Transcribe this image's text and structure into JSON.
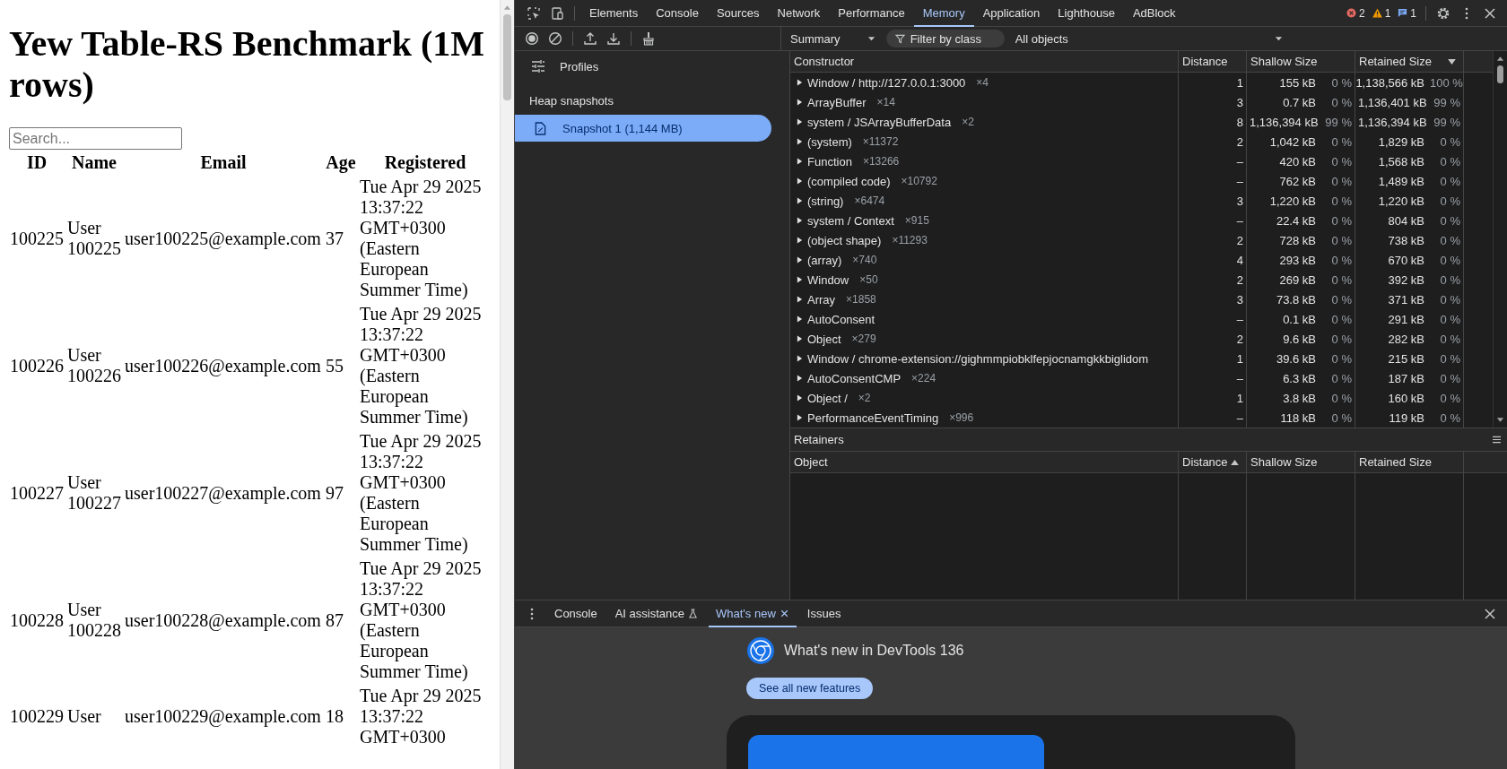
{
  "page": {
    "title": "Yew Table-RS Benchmark (1M rows)",
    "search": {
      "placeholder": "Search..."
    },
    "table": {
      "columns": [
        "ID",
        "Name",
        "Email",
        "Age",
        "Registered"
      ],
      "rows": [
        {
          "id": "100225",
          "name": "User 100225",
          "email": "user100225@example.com",
          "age": "37",
          "registered": "Tue Apr 29 2025 13:37:22 GMT+0300 (Eastern European Summer Time)"
        },
        {
          "id": "100226",
          "name": "User 100226",
          "email": "user100226@example.com",
          "age": "55",
          "registered": "Tue Apr 29 2025 13:37:22 GMT+0300 (Eastern European Summer Time)"
        },
        {
          "id": "100227",
          "name": "User 100227",
          "email": "user100227@example.com",
          "age": "97",
          "registered": "Tue Apr 29 2025 13:37:22 GMT+0300 (Eastern European Summer Time)"
        },
        {
          "id": "100228",
          "name": "User 100228",
          "email": "user100228@example.com",
          "age": "87",
          "registered": "Tue Apr 29 2025 13:37:22 GMT+0300 (Eastern European Summer Time)"
        },
        {
          "id": "100229",
          "name": "User",
          "email": "user100229@example.com",
          "age": "18",
          "registered": "Tue Apr 29 2025 13:37:22 GMT+0300"
        }
      ]
    }
  },
  "devtools": {
    "tabs": [
      {
        "label": "Elements",
        "selected": false
      },
      {
        "label": "Console",
        "selected": false
      },
      {
        "label": "Sources",
        "selected": false
      },
      {
        "label": "Network",
        "selected": false
      },
      {
        "label": "Performance",
        "selected": false
      },
      {
        "label": "Memory",
        "selected": true
      },
      {
        "label": "Application",
        "selected": false
      },
      {
        "label": "Lighthouse",
        "selected": false
      },
      {
        "label": "AdBlock",
        "selected": false
      }
    ],
    "status": {
      "errors": "2",
      "warnings": "1",
      "messages": "1"
    },
    "toolbar": {
      "view": "Summary",
      "filter_placeholder": "Filter by class",
      "scope": "All objects"
    },
    "sidebar": {
      "profiles": "Profiles",
      "section": "Heap snapshots",
      "snapshots": [
        {
          "label": "Snapshot 1 (1,144 MB)",
          "selected": true
        }
      ]
    },
    "heap_table": {
      "columns": [
        {
          "label": "Constructor",
          "sorted": false
        },
        {
          "label": "Distance",
          "sorted": false
        },
        {
          "label": "Shallow Size",
          "sorted": false
        },
        {
          "label": "Retained Size",
          "sorted": true,
          "ascending": false
        }
      ],
      "rows": [
        {
          "constructor": "Window / http://127.0.0.1:3000",
          "count": "×4",
          "expanded": false,
          "distance": "1",
          "shallow": "155 kB",
          "shallow_pct": "0 %",
          "retained": "1,138,566 kB",
          "retained_pct": "100 %"
        },
        {
          "constructor": "ArrayBuffer",
          "count": "×14",
          "expanded": false,
          "distance": "3",
          "shallow": "0.7 kB",
          "shallow_pct": "0 %",
          "retained": "1,136,401 kB",
          "retained_pct": "99 %"
        },
        {
          "constructor": "system / JSArrayBufferData",
          "count": "×2",
          "expanded": false,
          "distance": "8",
          "shallow": "1,136,394 kB",
          "shallow_pct": "99 %",
          "retained": "1,136,394 kB",
          "retained_pct": "99 %"
        },
        {
          "constructor": "(system)",
          "count": "×11372",
          "expanded": false,
          "distance": "2",
          "shallow": "1,042 kB",
          "shallow_pct": "0 %",
          "retained": "1,829 kB",
          "retained_pct": "0 %"
        },
        {
          "constructor": "Function",
          "count": "×13266",
          "expanded": false,
          "distance": "–",
          "shallow": "420 kB",
          "shallow_pct": "0 %",
          "retained": "1,568 kB",
          "retained_pct": "0 %"
        },
        {
          "constructor": "(compiled code)",
          "count": "×10792",
          "expanded": false,
          "distance": "–",
          "shallow": "762 kB",
          "shallow_pct": "0 %",
          "retained": "1,489 kB",
          "retained_pct": "0 %"
        },
        {
          "constructor": "(string)",
          "count": "×6474",
          "expanded": false,
          "distance": "3",
          "shallow": "1,220 kB",
          "shallow_pct": "0 %",
          "retained": "1,220 kB",
          "retained_pct": "0 %"
        },
        {
          "constructor": "system / Context",
          "count": "×915",
          "expanded": false,
          "distance": "–",
          "shallow": "22.4 kB",
          "shallow_pct": "0 %",
          "retained": "804 kB",
          "retained_pct": "0 %"
        },
        {
          "constructor": "(object shape)",
          "count": "×11293",
          "expanded": false,
          "distance": "2",
          "shallow": "728 kB",
          "shallow_pct": "0 %",
          "retained": "738 kB",
          "retained_pct": "0 %"
        },
        {
          "constructor": "(array)",
          "count": "×740",
          "expanded": false,
          "distance": "4",
          "shallow": "293 kB",
          "shallow_pct": "0 %",
          "retained": "670 kB",
          "retained_pct": "0 %"
        },
        {
          "constructor": "Window",
          "count": "×50",
          "expanded": false,
          "distance": "2",
          "shallow": "269 kB",
          "shallow_pct": "0 %",
          "retained": "392 kB",
          "retained_pct": "0 %"
        },
        {
          "constructor": "Array",
          "count": "×1858",
          "expanded": false,
          "distance": "3",
          "shallow": "73.8 kB",
          "shallow_pct": "0 %",
          "retained": "371 kB",
          "retained_pct": "0 %"
        },
        {
          "constructor": "AutoConsent",
          "expanded": false,
          "distance": "–",
          "shallow": "0.1 kB",
          "shallow_pct": "0 %",
          "retained": "291 kB",
          "retained_pct": "0 %"
        },
        {
          "constructor": "Object",
          "count": "×279",
          "expanded": false,
          "distance": "2",
          "shallow": "9.6 kB",
          "shallow_pct": "0 %",
          "retained": "282 kB",
          "retained_pct": "0 %"
        },
        {
          "constructor": "Window / chrome-extension://gighmmpiobklfepjocnamgkkbiglidom",
          "expanded": false,
          "distance": "1",
          "shallow": "39.6 kB",
          "shallow_pct": "0 %",
          "retained": "215 kB",
          "retained_pct": "0 %"
        },
        {
          "constructor": "AutoConsentCMP",
          "count": "×224",
          "expanded": false,
          "distance": "–",
          "shallow": "6.3 kB",
          "shallow_pct": "0 %",
          "retained": "187 kB",
          "retained_pct": "0 %"
        },
        {
          "constructor": "Object /",
          "count": "×2",
          "expanded": false,
          "distance": "1",
          "shallow": "3.8 kB",
          "shallow_pct": "0 %",
          "retained": "160 kB",
          "retained_pct": "0 %"
        },
        {
          "constructor": "PerformanceEventTiming",
          "count": "×996",
          "expanded": false,
          "distance": "–",
          "shallow": "118 kB",
          "shallow_pct": "0 %",
          "retained": "119 kB",
          "retained_pct": "0 %"
        }
      ]
    },
    "retainers": {
      "title": "Retainers",
      "columns": [
        {
          "label": "Object",
          "sorted": false
        },
        {
          "label": "Distance",
          "sorted": true,
          "ascending": true
        },
        {
          "label": "Shallow Size",
          "sorted": false
        },
        {
          "label": "Retained Size",
          "sorted": false
        }
      ]
    },
    "drawer": {
      "tabs": [
        {
          "label": "Console",
          "selected": false,
          "experimental": false,
          "closable": false
        },
        {
          "label": "AI assistance",
          "selected": false,
          "experimental": true,
          "closable": false
        },
        {
          "label": "What's new",
          "selected": true,
          "experimental": false,
          "closable": true
        },
        {
          "label": "Issues",
          "selected": false,
          "experimental": false,
          "closable": false
        }
      ],
      "heading": "What's new in DevTools 136",
      "button": "See all new features"
    }
  }
}
